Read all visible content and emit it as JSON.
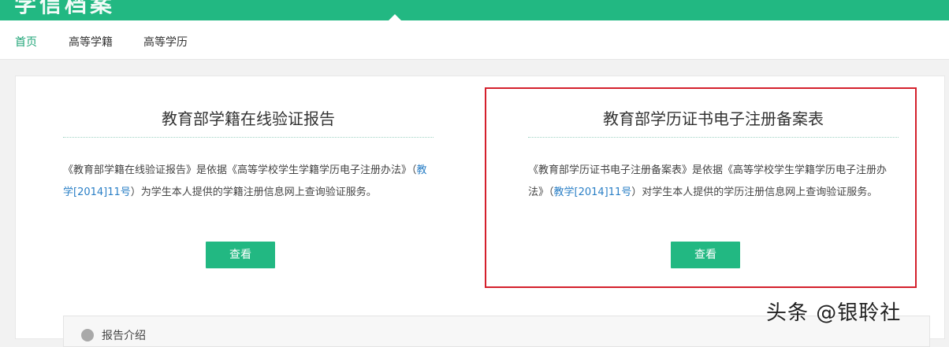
{
  "header": {
    "logo_text": "学信档案"
  },
  "nav": {
    "items": [
      {
        "label": "首页"
      },
      {
        "label": "高等学籍"
      },
      {
        "label": "高等学历"
      }
    ]
  },
  "main": {
    "left": {
      "title": "教育部学籍在线验证报告",
      "desc_before_link": "《教育部学籍在线验证报告》是依据《高等学校学生学籍学历电子注册办法》（",
      "desc_link": "教学[2014]11号",
      "desc_after_link": "）为学生本人提供的学籍注册信息网上查询验证服务。",
      "button_label": "查看"
    },
    "right": {
      "title": "教育部学历证书电子注册备案表",
      "desc_before_link": "《教育部学历证书电子注册备案表》是依据《高等学校学生学籍学历电子注册办法》（",
      "desc_link": "教学[2014]11号",
      "desc_after_link": "）对学生本人提供的学历注册信息网上查询验证服务。",
      "button_label": "查看"
    }
  },
  "bottom": {
    "label": "报告介绍"
  },
  "watermark": {
    "text": "头条 @银聆社"
  },
  "colors": {
    "brand_green": "#22b882",
    "link_blue": "#2a7fc6",
    "highlight_red": "#d4202c"
  }
}
